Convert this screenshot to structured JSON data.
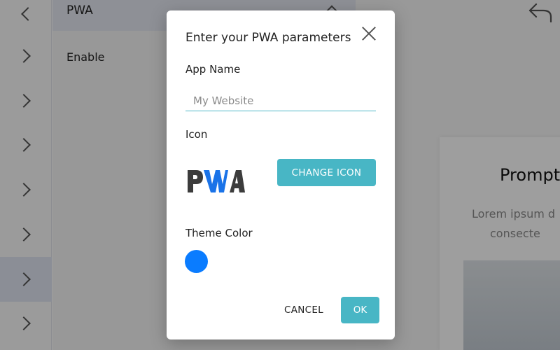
{
  "rail": {
    "items": [
      {
        "icon": "chevron-left-icon"
      },
      {
        "icon": "chevron-right-icon"
      },
      {
        "icon": "chevron-right-icon"
      },
      {
        "icon": "chevron-right-icon"
      },
      {
        "icon": "chevron-right-icon"
      },
      {
        "icon": "chevron-right-icon"
      },
      {
        "icon": "chevron-right-icon",
        "selected": true
      },
      {
        "icon": "chevron-right-icon"
      }
    ]
  },
  "panel": {
    "title": "PWA",
    "enable_label": "Enable"
  },
  "preview": {
    "title": "Prompt",
    "text_line1": "Lorem ipsum d",
    "text_line2": "consecte",
    "undo_icon": "undo-icon"
  },
  "dialog": {
    "title": "Enter your PWA parameters",
    "close_icon": "close-icon",
    "app_name_label": "App Name",
    "app_name_placeholder": "My Website",
    "app_name_value": "",
    "icon_label": "Icon",
    "change_icon_label": "CHANGE ICON",
    "theme_color_label": "Theme Color",
    "theme_color": "#0a7cff",
    "cancel_label": "CANCEL",
    "ok_label": "OK"
  },
  "colors": {
    "accent": "#48b6c5",
    "overlay": "rgba(0,0,0,0.38)"
  }
}
